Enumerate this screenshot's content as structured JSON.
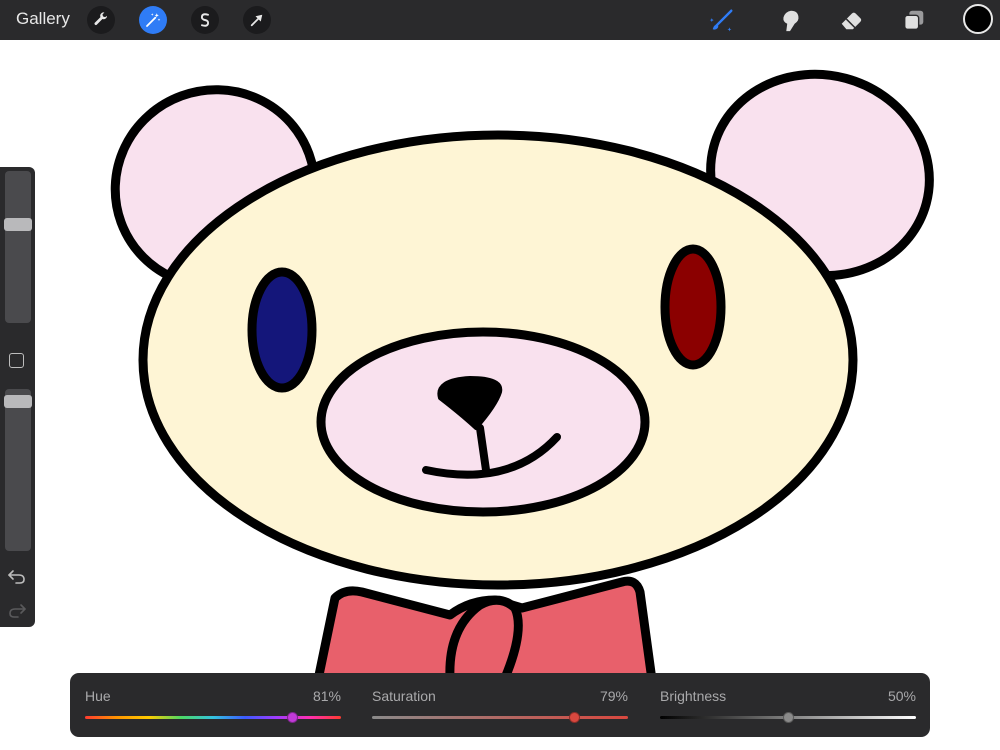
{
  "toolbar": {
    "gallery_label": "Gallery",
    "left_tools": [
      "wrench-icon",
      "magic-wand-icon",
      "selection-s-icon",
      "transform-arrow-icon"
    ],
    "active_tool": "magic-wand-icon",
    "right_tools": [
      "brush-icon",
      "smudge-icon",
      "eraser-icon",
      "layers-icon"
    ],
    "active_right_tool": "brush-icon",
    "current_color": "#000000",
    "accent": "#2f7cf6"
  },
  "sidebar": {
    "brush_size_level": 0.66,
    "opacity_level": 0.96,
    "icons": [
      "modify-square-icon",
      "undo-icon",
      "redo-icon"
    ]
  },
  "color_panel": {
    "hue": {
      "label": "Hue",
      "value_text": "81%",
      "level": 0.81,
      "knob_color": "#c23ad8"
    },
    "saturation": {
      "label": "Saturation",
      "value_text": "79%",
      "level": 0.79,
      "knob_color": "#d9483f"
    },
    "brightness": {
      "label": "Brightness",
      "value_text": "50%",
      "level": 0.5,
      "knob_color": "#8a8a8a"
    }
  },
  "artwork": {
    "ear_fill": "#f9e1ee",
    "face_fill": "#fef5d5",
    "muzzle_fill": "#f9e1ee",
    "left_eye": "#14167a",
    "right_eye": "#8b0000",
    "bow_fill": "#e8606b",
    "outline": "#000000"
  }
}
